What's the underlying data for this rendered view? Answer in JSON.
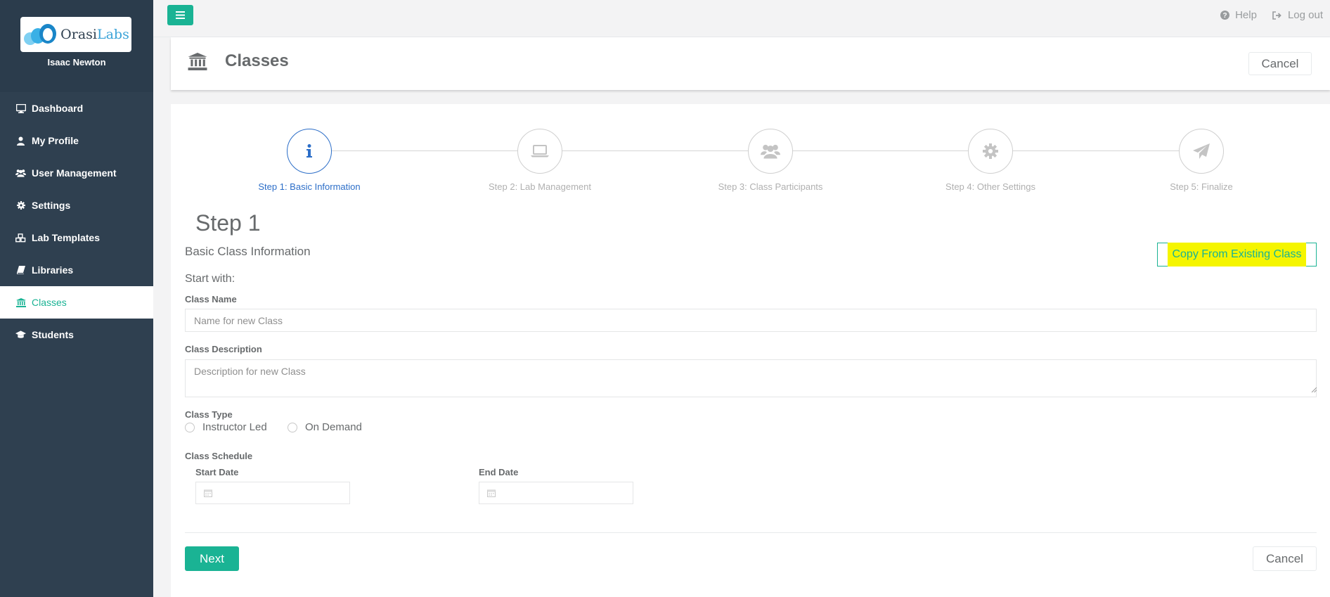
{
  "brand": {
    "logo_part1": "Orasi",
    "logo_part2": "Labs",
    "user_name": "Isaac Newton"
  },
  "sidebar": {
    "items": [
      {
        "label": "Dashboard",
        "icon": "desktop-icon"
      },
      {
        "label": "My Profile",
        "icon": "user-icon"
      },
      {
        "label": "User Management",
        "icon": "users-icon"
      },
      {
        "label": "Settings",
        "icon": "gear-icon"
      },
      {
        "label": "Lab Templates",
        "icon": "cubes-icon"
      },
      {
        "label": "Libraries",
        "icon": "book-icon"
      },
      {
        "label": "Classes",
        "icon": "institution-icon",
        "active": true
      },
      {
        "label": "Students",
        "icon": "graduation-cap-icon"
      }
    ]
  },
  "topbar": {
    "help_label": "Help",
    "logout_label": "Log out"
  },
  "heading": {
    "title": "Classes",
    "cancel_label": "Cancel"
  },
  "wizard": {
    "steps": [
      {
        "label": "Step 1: Basic Information",
        "icon": "info-icon",
        "current": true
      },
      {
        "label": "Step 2: Lab Management",
        "icon": "laptop-icon"
      },
      {
        "label": "Step 3: Class Participants",
        "icon": "users-icon"
      },
      {
        "label": "Step 4: Other Settings",
        "icon": "gear-icon"
      },
      {
        "label": "Step 5: Finalize",
        "icon": "paper-plane-icon"
      }
    ]
  },
  "form": {
    "step_heading": "Step 1",
    "section_title": "Basic Class Information",
    "copy_button_label": "Copy From Existing Class",
    "start_with_label": "Start with:",
    "class_name_label": "Class Name",
    "class_name_placeholder": "Name for new Class",
    "class_name_value": "",
    "class_description_label": "Class Description",
    "class_description_placeholder": "Description for new Class",
    "class_type_label": "Class Type",
    "class_type_options": [
      "Instructor Led",
      "On Demand"
    ],
    "class_schedule_label": "Class Schedule",
    "start_date_label": "Start Date",
    "end_date_label": "End Date",
    "next_label": "Next",
    "cancel_label": "Cancel"
  },
  "colors": {
    "accent": "#1ab394",
    "sidebar": "#2f4050",
    "step_active": "#2c6ec8",
    "highlight": "#f5f500"
  }
}
